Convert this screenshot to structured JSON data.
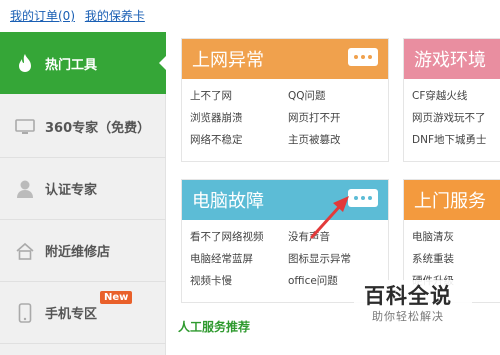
{
  "top_links": {
    "orders": "我的订单(0)",
    "warranty": "我的保养卡"
  },
  "sidebar": {
    "items": [
      {
        "label": "热门工具",
        "icon": "flame-icon",
        "active": true
      },
      {
        "label": "360专家（免费）",
        "icon": "monitor-icon"
      },
      {
        "label": "认证专家",
        "icon": "person-icon"
      },
      {
        "label": "附近维修店",
        "icon": "home-icon"
      },
      {
        "label": "手机专区",
        "icon": "phone-icon",
        "badge": "New"
      }
    ]
  },
  "cards": {
    "internet": {
      "title": "上网异常",
      "color": "#f0a14d",
      "links": [
        "上不了网",
        "QQ问题",
        "浏览器崩溃",
        "网页打不开",
        "网络不稳定",
        "主页被篡改"
      ]
    },
    "game": {
      "title": "游戏环境",
      "color": "#e98ea0",
      "links": [
        "CF穿越火线",
        "网页游戏玩不了",
        "DNF地下城勇士"
      ]
    },
    "pc": {
      "title": "电脑故障",
      "color": "#5cbcd6",
      "links": [
        "看不了网络视频",
        "没有声音",
        "电脑经常蓝屏",
        "图标显示异常",
        "视频卡慢",
        "office问题"
      ]
    },
    "onsite": {
      "title": "上门服务",
      "color": "#f39a3e",
      "links": [
        "电脑清灰",
        "系统重装",
        "硬件升级"
      ]
    }
  },
  "section_title": "人工服务推荐",
  "watermark": {
    "title": "百科全说",
    "subtitle": "助你轻松解决"
  },
  "annotation_color": "#e33a3a"
}
